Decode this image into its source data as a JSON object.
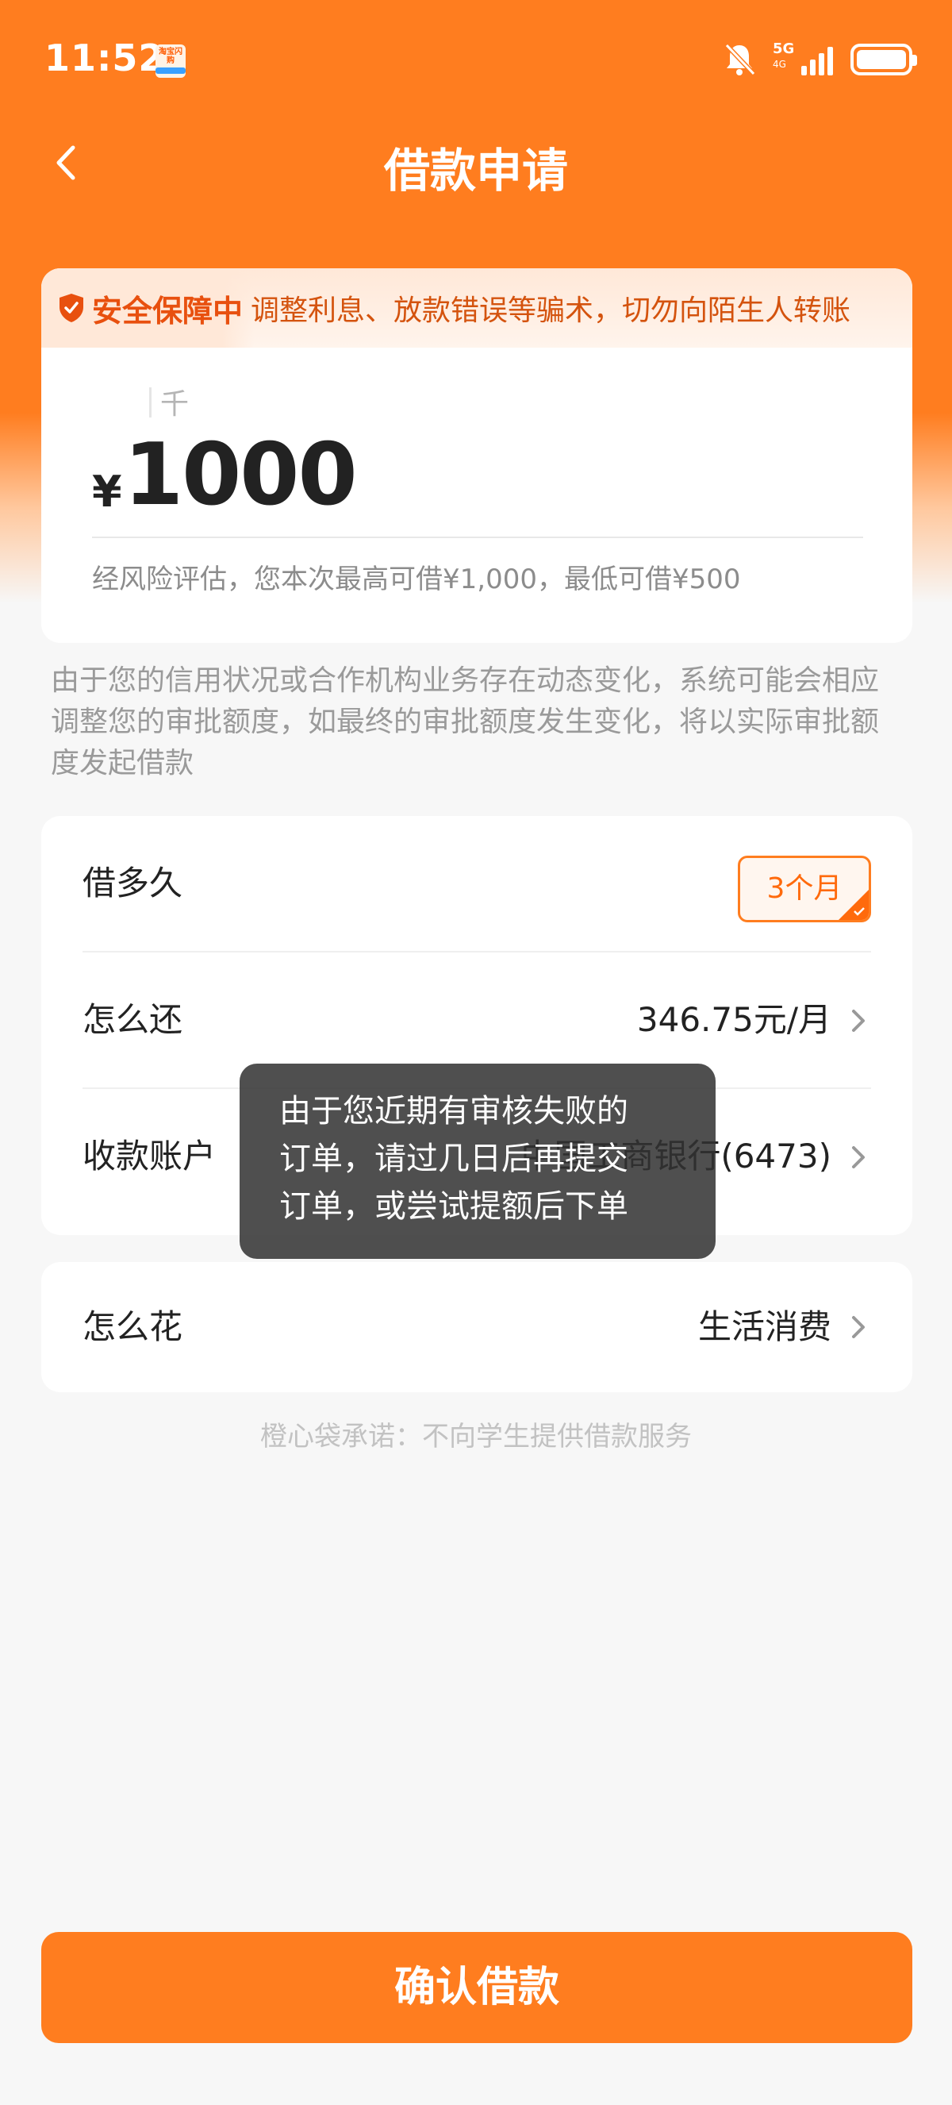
{
  "status_bar": {
    "time": "11:52",
    "app_badge": "淘宝闪购",
    "network": "5G",
    "network_sub": "4G"
  },
  "nav": {
    "title": "借款申请"
  },
  "amount_card": {
    "safety_label": "安全保障中",
    "safety_marquee": "调整利息、放款错误等骗术，切勿向陌生人转账",
    "unit_hint": "千",
    "currency_symbol": "¥",
    "amount": "1000",
    "limit_hint": "经风险评估，您本次最高可借¥1,000，最低可借¥500"
  },
  "notice": "由于您的信用状况或合作机构业务存在动态变化，系统可能会相应调整您的审批额度，如最终的审批额度发生变化，将以实际审批额度发起借款",
  "options": {
    "term": {
      "label": "借多久",
      "value": "3个月"
    },
    "repay": {
      "label": "怎么还",
      "value": "346.75元/月"
    },
    "account": {
      "label": "收款账户",
      "value": "中国工商银行(6473)"
    }
  },
  "spend": {
    "label": "怎么花",
    "value": "生活消费"
  },
  "promise": "橙心袋承诺：不向学生提供借款服务",
  "toast": {
    "line1": "由于您近期有审核失败的",
    "line2": "订单，请过几日后再提交",
    "line3": "订单，或尝试提额后下单"
  },
  "confirm_button": "确认借款",
  "colors": {
    "brand": "#ff7d1f",
    "accent_text": "#ff6a0c",
    "toast_bg": "#323232"
  }
}
